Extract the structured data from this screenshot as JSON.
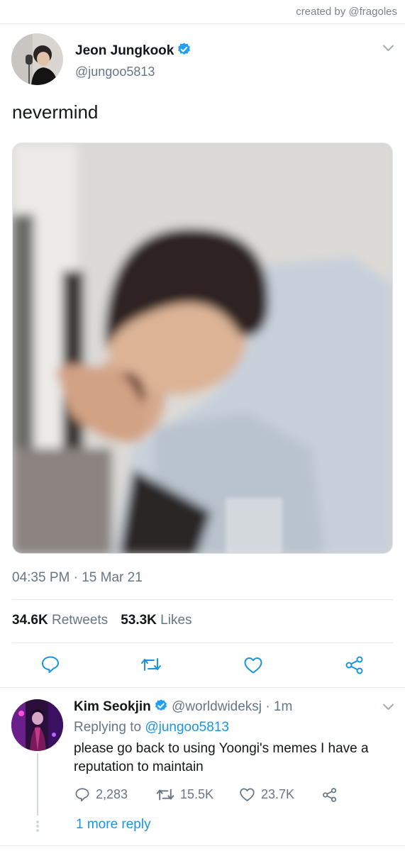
{
  "credit": "created by @fragoles",
  "tweet": {
    "name": "Jeon Jungkook",
    "handle": "@jungoo5813",
    "text": "nevermind",
    "timestamp": "04:35 PM · 15 Mar 21",
    "retweets_count": "34.6K",
    "retweets_label": "Retweets",
    "likes_count": "53.3K",
    "likes_label": "Likes"
  },
  "reply": {
    "name": "Kim Seokjin",
    "handle": "@worldwideksj",
    "time": "· 1m",
    "replying_prefix": "Replying to",
    "replying_to": "@jungoo5813",
    "text": "please go back to using Yoongi's memes I have a reputation to maintain",
    "reply_count": "2,283",
    "retweet_count": "15.5K",
    "like_count": "23.7K",
    "more_replies": "1 more reply"
  },
  "colors": {
    "accent": "#1b95e0",
    "verified": "#1da1f2",
    "secondary_text": "#657786",
    "icon": "#1b95e0"
  },
  "icons": [
    "chevron-down-icon",
    "verified-badge-icon",
    "reply-icon",
    "retweet-icon",
    "like-icon",
    "share-icon"
  ]
}
